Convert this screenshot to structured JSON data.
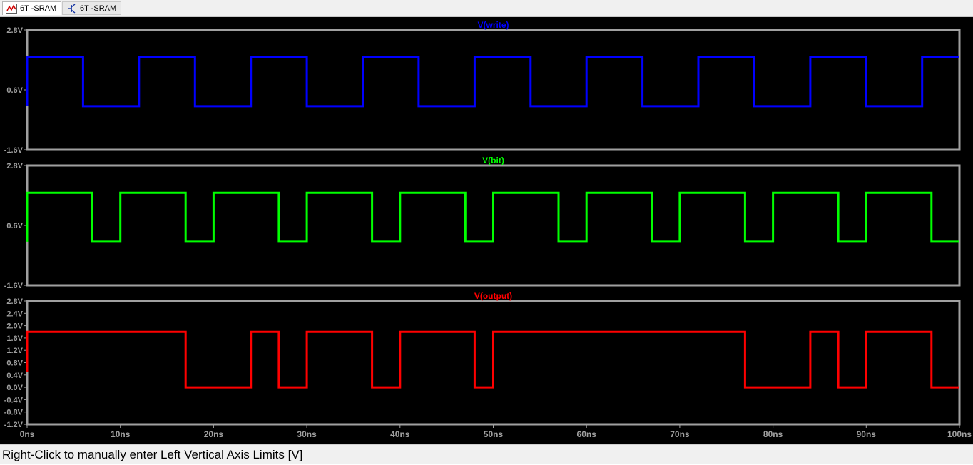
{
  "tabs": [
    {
      "label": "6T -SRAM",
      "icon": "waveform-icon",
      "active": true
    },
    {
      "label": "6T -SRAM",
      "icon": "schematic-icon",
      "active": false
    }
  ],
  "status_text": "Right-Click to manually enter Left Vertical Axis Limits [V]",
  "colors": {
    "background": "#000000",
    "frame": "#a0a0a0",
    "tick_label": "#a0a0a0",
    "write": "#0000ff",
    "bit": "#00ff00",
    "output": "#ff0000"
  },
  "chart_data": [
    {
      "type": "line",
      "title": "V(write)",
      "color": "#0000ff",
      "ylim": [
        -1.6,
        2.8
      ],
      "yticks": [
        "2.8V",
        "0.6V",
        "-1.6V"
      ],
      "yticks_values": [
        2.8,
        0.6,
        -1.6
      ],
      "xlim": [
        0,
        100
      ],
      "series": [
        {
          "name": "V(write)",
          "x": [
            0,
            0,
            6,
            6,
            12,
            12,
            18,
            18,
            24,
            24,
            30,
            30,
            36,
            36,
            42,
            42,
            48,
            48,
            54,
            54,
            60,
            60,
            66,
            66,
            72,
            72,
            78,
            78,
            84,
            84,
            90,
            90,
            96,
            96,
            100
          ],
          "y": [
            0,
            1.8,
            1.8,
            0,
            0,
            1.8,
            1.8,
            0,
            0,
            1.8,
            1.8,
            0,
            0,
            1.8,
            1.8,
            0,
            0,
            1.8,
            1.8,
            0,
            0,
            1.8,
            1.8,
            0,
            0,
            1.8,
            1.8,
            0,
            0,
            1.8,
            1.8,
            0,
            0,
            1.8,
            1.8
          ]
        }
      ]
    },
    {
      "type": "line",
      "title": "V(bit)",
      "color": "#00ff00",
      "ylim": [
        -1.6,
        2.8
      ],
      "yticks": [
        "2.8V",
        "0.6V",
        "-1.6V"
      ],
      "yticks_values": [
        2.8,
        0.6,
        -1.6
      ],
      "xlim": [
        0,
        100
      ],
      "series": [
        {
          "name": "V(bit)",
          "x": [
            0,
            0,
            7,
            7,
            10,
            10,
            17,
            17,
            20,
            20,
            27,
            27,
            30,
            30,
            37,
            37,
            40,
            40,
            47,
            47,
            50,
            50,
            57,
            57,
            60,
            60,
            67,
            67,
            70,
            70,
            77,
            77,
            80,
            80,
            87,
            87,
            90,
            90,
            97,
            97,
            100
          ],
          "y": [
            0,
            1.8,
            1.8,
            0,
            0,
            1.8,
            1.8,
            0,
            0,
            1.8,
            1.8,
            0,
            0,
            1.8,
            1.8,
            0,
            0,
            1.8,
            1.8,
            0,
            0,
            1.8,
            1.8,
            0,
            0,
            1.8,
            1.8,
            0,
            0,
            1.8,
            1.8,
            0,
            0,
            1.8,
            1.8,
            0,
            0,
            1.8,
            1.8,
            0,
            0
          ]
        }
      ]
    },
    {
      "type": "line",
      "title": "V(output)",
      "color": "#ff0000",
      "ylim": [
        -1.2,
        2.8
      ],
      "yticks": [
        "2.8V",
        "2.4V",
        "2.0V",
        "1.6V",
        "1.2V",
        "0.8V",
        "0.4V",
        "0.0V",
        "-0.4V",
        "-0.8V",
        "-1.2V"
      ],
      "yticks_values": [
        2.8,
        2.4,
        2.0,
        1.6,
        1.2,
        0.8,
        0.4,
        0.0,
        -0.4,
        -0.8,
        -1.2
      ],
      "xlim": [
        0,
        100
      ],
      "xticks": [
        "0ns",
        "10ns",
        "20ns",
        "30ns",
        "40ns",
        "50ns",
        "60ns",
        "70ns",
        "80ns",
        "90ns",
        "100ns"
      ],
      "xticks_values": [
        0,
        10,
        20,
        30,
        40,
        50,
        60,
        70,
        80,
        90,
        100
      ],
      "series": [
        {
          "name": "V(output)",
          "x": [
            0,
            0,
            17,
            17,
            24,
            24,
            27,
            27,
            30,
            30,
            37,
            37,
            40,
            40,
            48,
            48,
            50,
            50,
            77,
            77,
            84,
            84,
            87,
            87,
            90,
            90,
            97,
            97,
            100
          ],
          "y": [
            0.5,
            1.8,
            1.8,
            0,
            0,
            1.8,
            1.8,
            0,
            0,
            1.8,
            1.8,
            0,
            0,
            1.8,
            1.8,
            0,
            0,
            1.8,
            1.8,
            0,
            0,
            1.8,
            1.8,
            0,
            0,
            1.8,
            1.8,
            0,
            0
          ]
        }
      ]
    }
  ]
}
